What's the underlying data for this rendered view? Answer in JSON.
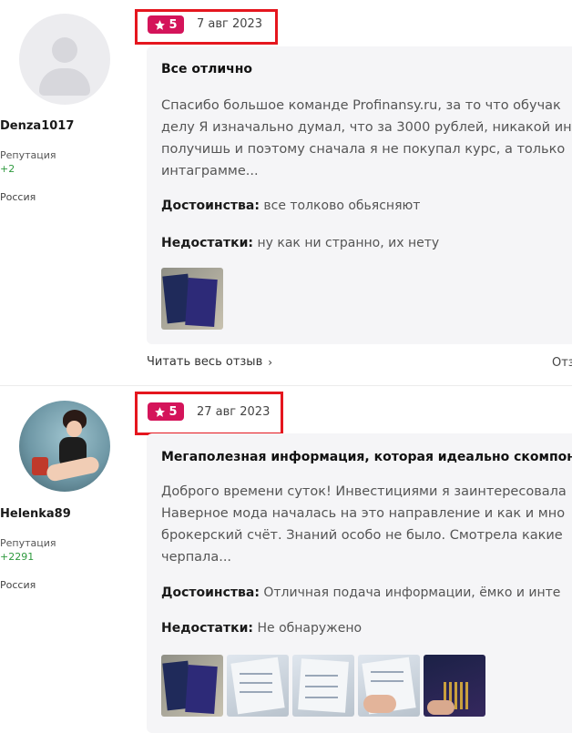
{
  "reviews": [
    {
      "author": {
        "name": "Denza1017",
        "reputation_label": "Репутация",
        "reputation": "+2",
        "country": "Россия",
        "avatar": "default-avatar"
      },
      "rating": "5",
      "date": "7 авг 2023",
      "title": "Все отлично",
      "text_lines": [
        "Спасибо большое команде Profinansy.ru, за то что обучак",
        "делу Я изначально думал, что за 3000 рублей, никакой ин",
        "получишь и поэтому сначала я не покупал курс, а только",
        "интаграмме..."
      ],
      "pros_label": "Достоинства:",
      "pros": "все толково обьясняют",
      "cons_label": "Недостатки:",
      "cons": "ну как ни странно, их нету",
      "photos": [
        "book-photo"
      ],
      "read_more": "Читать весь отзыв",
      "side_text": "Отз"
    },
    {
      "author": {
        "name": "Helenka89",
        "reputation_label": "Репутация",
        "reputation": "+2291",
        "country": "Россия",
        "avatar": "user-photo"
      },
      "rating": "5",
      "date": "27 авг 2023",
      "title": "Мегаполезная информация, которая идеально скомпоно",
      "text_lines": [
        "Доброго времени суток! Инвестициями я заинтересовала",
        "Наверное мода началась на это направление и как и мно",
        "брокерский счёт. Знаний особо не было. Смотрела какие",
        "черпала..."
      ],
      "pros_label": "Достоинства:",
      "pros": "Отличная подача информации, ёмко и инте",
      "cons_label": "Недостатки:",
      "cons": "Не обнаружено",
      "photos": [
        "book-photo",
        "document-photo",
        "document-photo",
        "hand-document-photo",
        "night-book-photo"
      ]
    }
  ],
  "colors": {
    "highlight": "#e5161e",
    "badge": "#d4145a",
    "reputation": "#2f9a3f",
    "card": "#f5f5f7"
  },
  "icons": {
    "star": "star-icon",
    "chevron": "chevron-right-icon"
  }
}
